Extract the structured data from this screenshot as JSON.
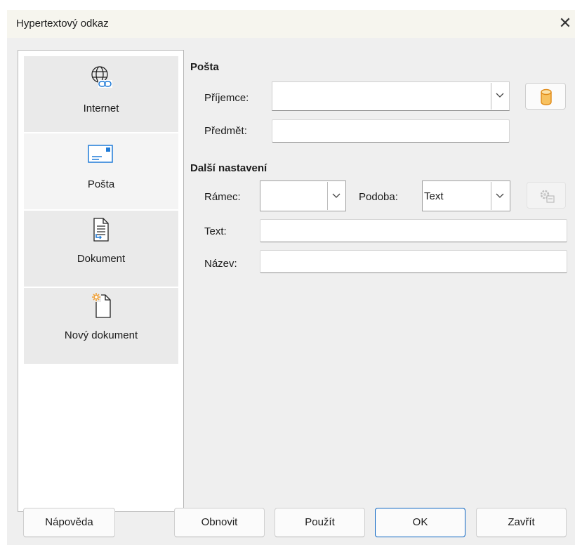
{
  "window": {
    "title": "Hypertextový odkaz",
    "close_glyph": "✕"
  },
  "sidebar": {
    "items": [
      {
        "label": "Internet",
        "icon": "globe-link-icon"
      },
      {
        "label": "Pošta",
        "icon": "mail-envelope-icon",
        "selected": true
      },
      {
        "label": "Dokument",
        "icon": "document-icon"
      },
      {
        "label": "Nový dokument",
        "icon": "new-document-icon"
      }
    ]
  },
  "mail": {
    "heading": "Pošta",
    "recipient_label": "Příjemce:",
    "recipient_value": "",
    "subject_label": "Předmět:",
    "subject_value": "",
    "datasource_icon": "database-icon"
  },
  "more": {
    "heading": "Další nastavení",
    "frame_label": "Rámec:",
    "frame_value": "",
    "form_label": "Podoba:",
    "form_value": "Text",
    "events_icon": "events-gear-icon",
    "text_label": "Text:",
    "text_value": "",
    "name_label": "Název:",
    "name_value": ""
  },
  "buttons": {
    "help": "Nápověda",
    "reset": "Obnovit",
    "apply": "Použít",
    "ok": "OK",
    "close": "Zavřít"
  },
  "colors": {
    "accent": "#0a64c2",
    "icon_blue": "#1f7bd8",
    "db_orange": "#f0a23a"
  }
}
